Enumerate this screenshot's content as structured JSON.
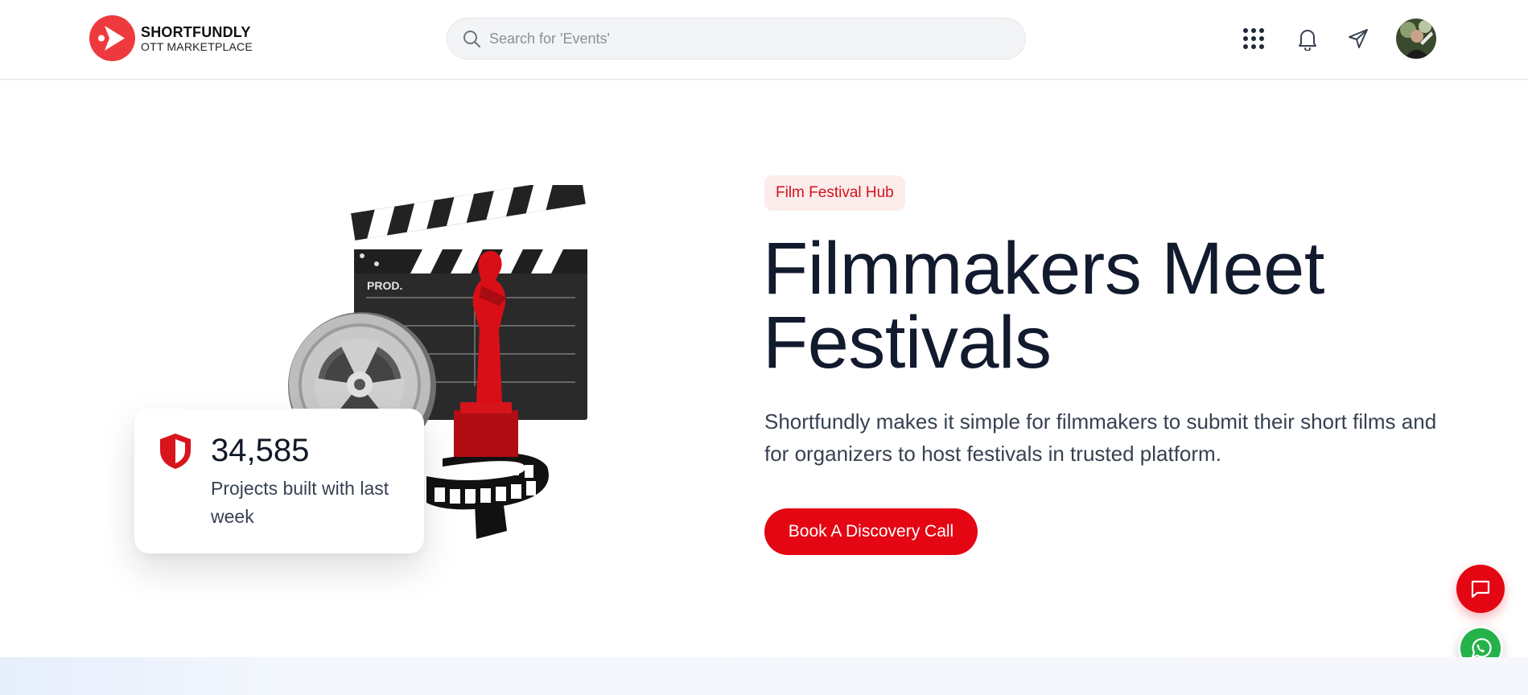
{
  "brand": {
    "title": "SHORTFUNDLY",
    "subtitle": "OTT MARKETPLACE",
    "accent_color": "#ee3a3f"
  },
  "search": {
    "placeholder": "Search for 'Events'",
    "value": ""
  },
  "header_icons": [
    "apps-grid-icon",
    "bell-icon",
    "send-icon",
    "user-avatar"
  ],
  "hero": {
    "badge": "Film Festival Hub",
    "headline_line1": "Filmmakers Meet",
    "headline_line2": "Festivals",
    "description": "Shortfundly makes it simple for filmmakers to submit their short films and for organizers to host festivals in trusted platform.",
    "cta_label": "Book A Discovery Call",
    "illustration_text": "PROD.",
    "stat": {
      "value": "34,585",
      "label": "Projects built with last week"
    }
  },
  "colors": {
    "primary_red": "#e40613",
    "headline": "#121a2e",
    "badge_bg": "#fdecec",
    "whatsapp_green": "#25b24a"
  },
  "floating_buttons": [
    "chat-icon",
    "whatsapp-icon"
  ]
}
